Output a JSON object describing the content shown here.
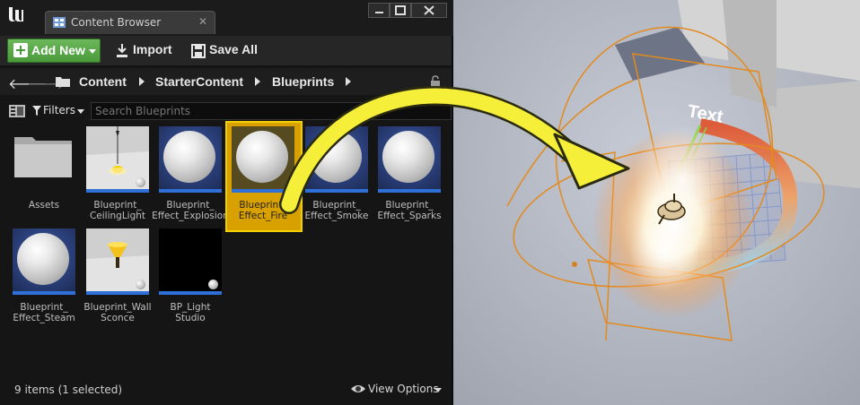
{
  "window": {
    "tab_title": "Content Browser",
    "tab_close": "✕"
  },
  "toolbar": {
    "add_new_label": "Add New",
    "import_label": "Import",
    "save_all_label": "Save All"
  },
  "path": {
    "crumbs": [
      "Content",
      "StarterContent",
      "Blueprints"
    ]
  },
  "filters": {
    "filters_label": "Filters",
    "search_placeholder": "Search Blueprints"
  },
  "assets": [
    {
      "label_1": "Assets",
      "label_2": "",
      "kind": "folder"
    },
    {
      "label_1": "Blueprint_",
      "label_2": "CeilingLight",
      "kind": "light"
    },
    {
      "label_1": "Blueprint_",
      "label_2": "Effect_Explosion",
      "kind": "sphere"
    },
    {
      "label_1": "Blueprint_",
      "label_2": "Effect_Fire",
      "kind": "sphere",
      "selected": true
    },
    {
      "label_1": "Blueprint_",
      "label_2": "Effect_Smoke",
      "kind": "sphere"
    },
    {
      "label_1": "Blueprint_",
      "label_2": "Effect_Sparks",
      "kind": "sphere"
    },
    {
      "label_1": "Blueprint_",
      "label_2": "Effect_Steam",
      "kind": "sphere"
    },
    {
      "label_1": "Blueprint_Wall",
      "label_2": "Sconce",
      "kind": "sconce"
    },
    {
      "label_1": "BP_Light",
      "label_2": "Studio",
      "kind": "studio"
    }
  ],
  "status": {
    "item_count": "9 items (1 selected)",
    "view_options_label": "View Options"
  },
  "viewport": {
    "text_actor_label": "Text"
  },
  "colors": {
    "add_new_green": "#4a9a3c",
    "selection_gold": "#d9a100",
    "thumb_bar_blue": "#2f6fd8",
    "arrow_yellow": "#f5ef3a"
  }
}
